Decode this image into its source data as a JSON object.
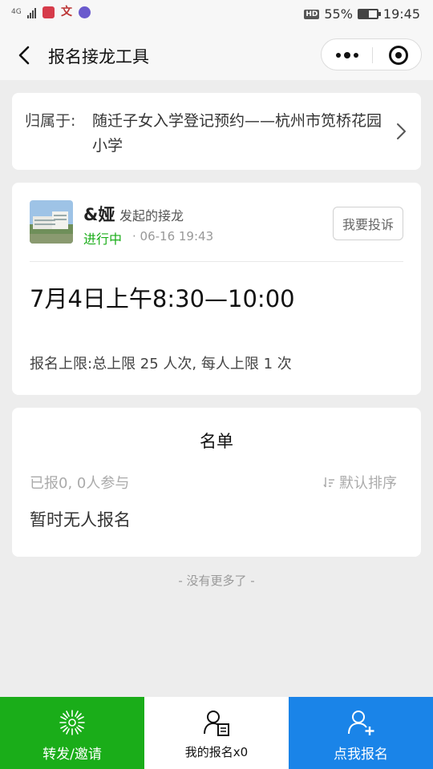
{
  "status_bar": {
    "network": "4G",
    "battery": "55%",
    "time": "19:45",
    "battery_level": 0.55
  },
  "nav": {
    "title": "报名接龙工具"
  },
  "belong": {
    "label": "归属于:",
    "text": "随迁子女入学登记预约——杭州市笕桥花园小学"
  },
  "info": {
    "creator": "&娅",
    "creator_suffix": "发起的接龙",
    "status": "进行中",
    "time": "· 06-16 19:43",
    "complain_label": "我要投诉",
    "event_title": "7月4日上午8:30—10:00",
    "limit": "报名上限:总上限 25 人次, 每人上限 1 次"
  },
  "roster": {
    "title": "名单",
    "count": "已报0, 0人参与",
    "sort_label": "默认排序",
    "empty": "暂时无人报名"
  },
  "footer_note": "- 没有更多了 -",
  "bottom": {
    "share_label": "转发/邀请",
    "mine_label": "我的报名x0",
    "join_label": "点我报名"
  },
  "colors": {
    "green": "#1aad19",
    "blue": "#1a84e8"
  }
}
